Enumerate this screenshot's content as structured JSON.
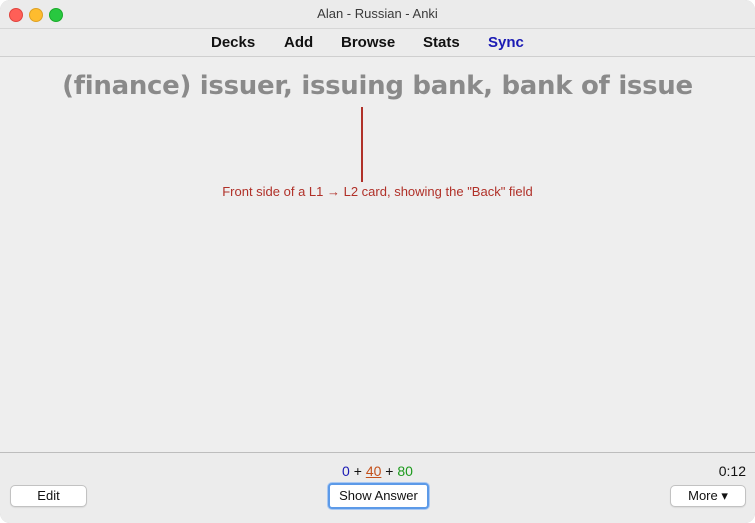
{
  "window": {
    "title": "Alan - Russian - Anki"
  },
  "toolbar": {
    "items": [
      "Decks",
      "Add",
      "Browse",
      "Stats",
      "Sync"
    ]
  },
  "card": {
    "question": "(finance) issuer, issuing bank, bank of issue",
    "annotation": "Front side of a L1 → L2 card, showing the \"Back\" field"
  },
  "counts": {
    "new": "0",
    "learning": "40",
    "review": "80",
    "separator": "+"
  },
  "timer": "0:12",
  "buttons": {
    "edit": "Edit",
    "show_answer": "Show Answer",
    "more": "More ▾"
  },
  "colors": {
    "new": "#1a1ab4",
    "learning": "#c4501a",
    "review": "#1c9a1c",
    "sync": "#1a1ab4",
    "annotation": "#b03028"
  }
}
